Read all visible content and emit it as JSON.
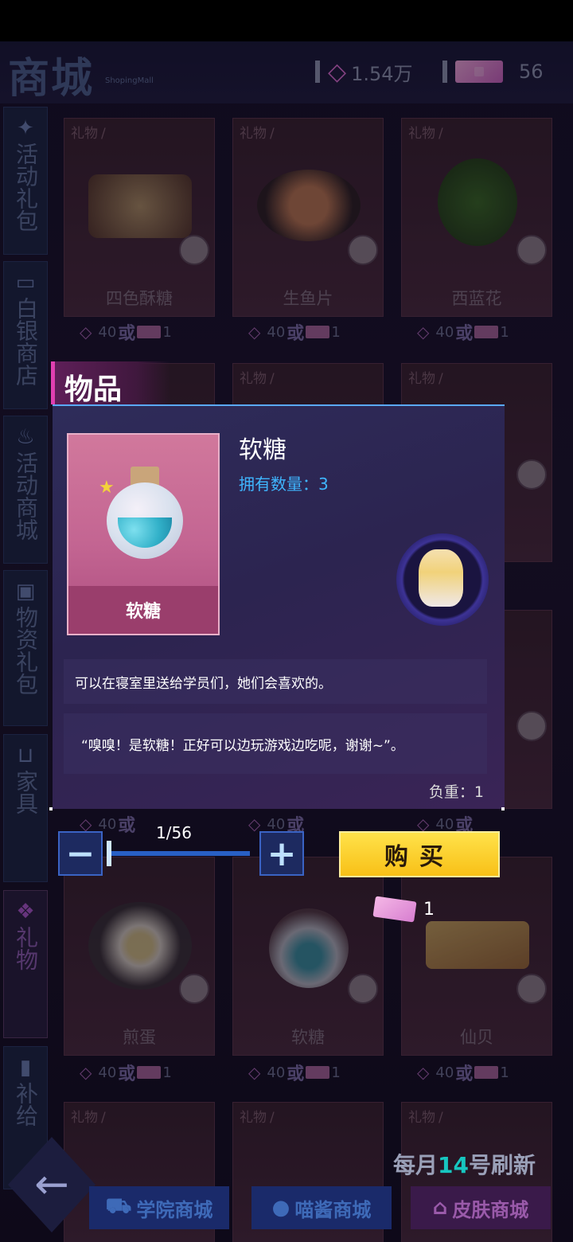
{
  "header": {
    "title": "商城",
    "subtitle": "ShopingMall",
    "crystal_amount": "1.54万",
    "ticket_amount": "56"
  },
  "sidebar": {
    "items": [
      {
        "label": "活动礼包",
        "icon": "sparkle-icon"
      },
      {
        "label": "白银商店",
        "icon": "card-icon"
      },
      {
        "label": "活动商城",
        "icon": "flame-icon"
      },
      {
        "label": "物资礼包",
        "icon": "crate-icon"
      },
      {
        "label": "家具",
        "icon": "sofa-icon"
      },
      {
        "label": "礼物",
        "icon": "gift-icon"
      },
      {
        "label": "补给",
        "icon": "battery-icon"
      }
    ]
  },
  "grid": {
    "tag": "礼物",
    "cards": [
      {
        "name": "四色酥糖"
      },
      {
        "name": "生鱼片"
      },
      {
        "name": "西蓝花"
      },
      {
        "name": ""
      },
      {
        "name": ""
      },
      {
        "name": ""
      },
      {
        "name": "煎蛋"
      },
      {
        "name": "软糖"
      },
      {
        "name": "仙贝"
      },
      {
        "name": ""
      },
      {
        "name": ""
      },
      {
        "name": ""
      }
    ],
    "price": {
      "crystals": "40",
      "or": "或",
      "tickets": "1"
    }
  },
  "popup": {
    "tab": "物品",
    "item_name": "软糖",
    "image_label": "软糖",
    "owned": "拥有数量：3",
    "description": "可以在寝室里送给学员们，她们会喜欢的。",
    "quote": "“嗅嗅！是软糖！正好可以边玩游戏边吃呢，谢谢~”。",
    "weight": "负重：1"
  },
  "purchase": {
    "quantity": "1/56",
    "minus": "−",
    "plus": "+",
    "buy_label": "购买",
    "cost": "1"
  },
  "footer": {
    "refresh_prefix": "每月",
    "refresh_day": "14",
    "refresh_suffix": "号刷新",
    "tabs": [
      {
        "label": "学院商城",
        "icon": "cart-icon"
      },
      {
        "label": "喵酱商城",
        "icon": "paw-icon"
      },
      {
        "label": "皮肤商城",
        "icon": "store-icon"
      }
    ]
  },
  "colors": {
    "accent": "#3fb6ff",
    "buy": "#f8c017",
    "tab_highlight": "#e03fb0"
  }
}
